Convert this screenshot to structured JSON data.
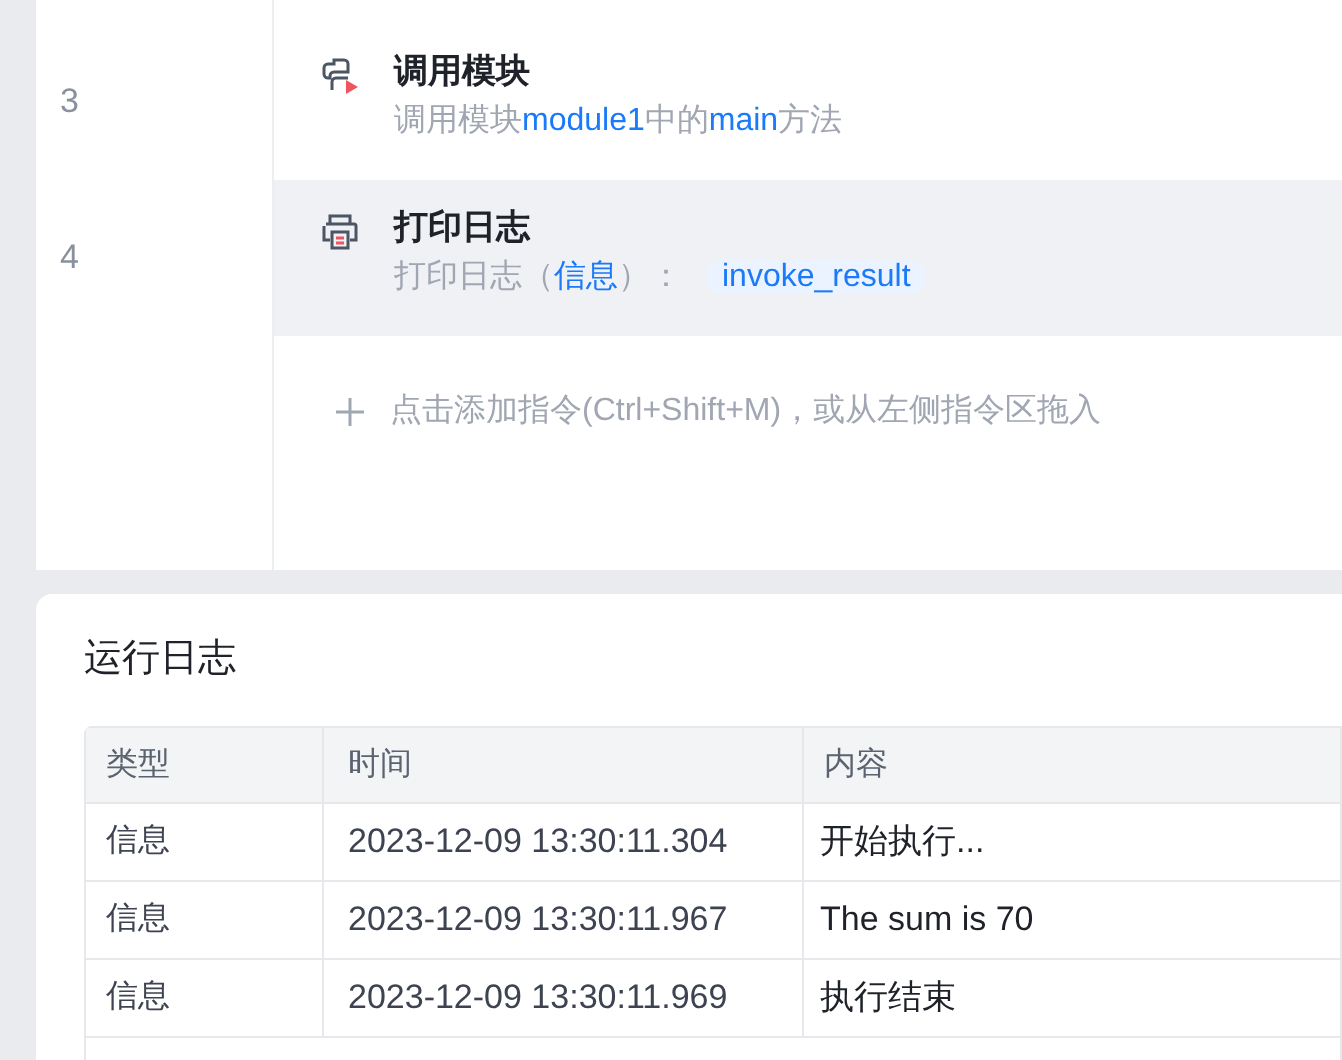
{
  "flow": {
    "steps": [
      {
        "number": "3",
        "kind": "module",
        "title": "调用模块",
        "selected": false,
        "parts": [
          {
            "kind": "plain",
            "text": "调用模块"
          },
          {
            "kind": "ref",
            "text": "module1"
          },
          {
            "kind": "plain",
            "text": "中的"
          },
          {
            "kind": "ref",
            "text": "main"
          },
          {
            "kind": "plain",
            "text": "方法"
          }
        ]
      },
      {
        "number": "4",
        "kind": "log",
        "title": "打印日志",
        "selected": true,
        "parts": [
          {
            "kind": "plain",
            "text": "打印日志（"
          },
          {
            "kind": "ref",
            "text": "信息"
          },
          {
            "kind": "plain",
            "text": "）："
          },
          {
            "kind": "chip",
            "text": "invoke_result"
          }
        ]
      }
    ],
    "add_hint": "点击添加指令(Ctrl+Shift+M)，或从左侧指令区拖入"
  },
  "log": {
    "title": "运行日志",
    "columns": [
      "类型",
      "时间",
      "内容"
    ],
    "rows": [
      [
        "信息",
        "2023-12-09 13:30:11.304",
        "开始执行..."
      ],
      [
        "信息",
        "2023-12-09 13:30:11.967",
        "The sum is 70"
      ],
      [
        "信息",
        "2023-12-09 13:30:11.969",
        "执行结束"
      ]
    ]
  }
}
